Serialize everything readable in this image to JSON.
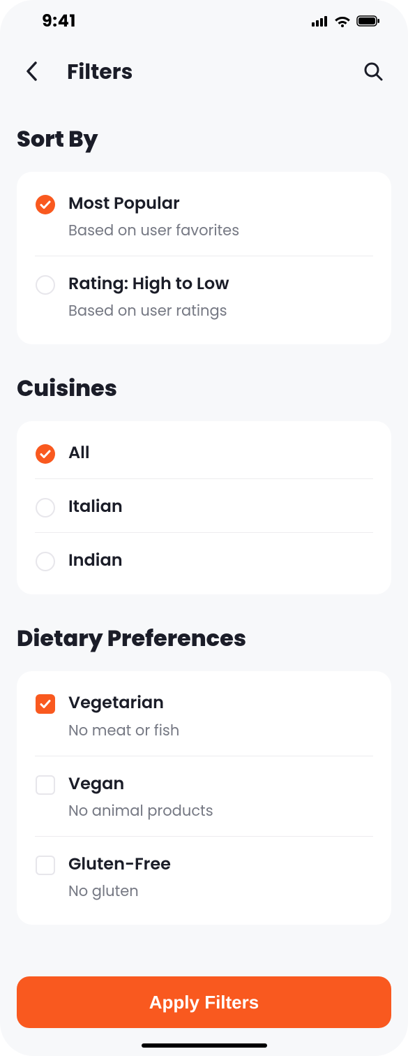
{
  "status": {
    "time": "9:41"
  },
  "header": {
    "title": "Filters"
  },
  "sections": {
    "sort": {
      "title": "Sort By",
      "options": [
        {
          "label": "Most Popular",
          "sub": "Based on user favorites",
          "checked": true
        },
        {
          "label": "Rating: High to Low",
          "sub": "Based on user ratings",
          "checked": false
        }
      ]
    },
    "cuisines": {
      "title": "Cuisines",
      "options": [
        {
          "label": "All",
          "checked": true
        },
        {
          "label": "Italian",
          "checked": false
        },
        {
          "label": "Indian",
          "checked": false
        }
      ]
    },
    "dietary": {
      "title": "Dietary Preferences",
      "options": [
        {
          "label": "Vegetarian",
          "sub": "No meat or fish",
          "checked": true
        },
        {
          "label": "Vegan",
          "sub": "No animal products",
          "checked": false
        },
        {
          "label": "Gluten-Free",
          "sub": "No gluten",
          "checked": false
        }
      ]
    }
  },
  "apply_label": "Apply Filters",
  "colors": {
    "accent": "#F9591F"
  }
}
